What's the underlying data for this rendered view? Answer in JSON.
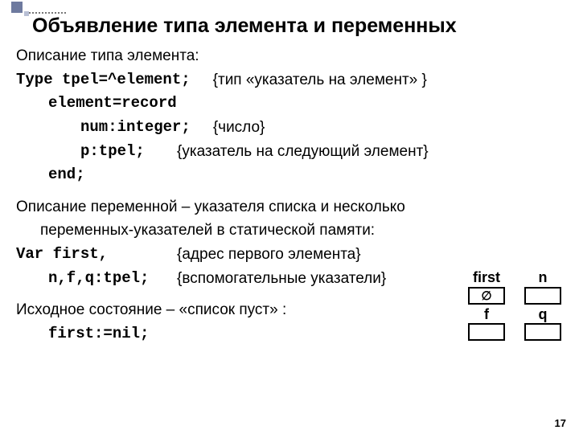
{
  "title": "Объявление типа элемента и переменных",
  "l1": "Описание типа элемента:",
  "l2a": "Type tpel=^element;",
  "l2b": "{тип «указатель на элемент» }",
  "l3": "element=record",
  "l4a": "num:integer;",
  "l4b": "{число}",
  "l5a": "p:tpel;",
  "l5b": "{указатель на следующий элемент}",
  "l6": "end;",
  "p2a": "Описание переменной – указателя  списка и несколько",
  "p2b": "переменных-указателей в статической памяти:",
  "l7a": "Var first,",
  "l7b": "{адрес первого элемента}",
  "l8a": "n,f,q:tpel;",
  "l8b": "{вспомогательные указатели}",
  "p3": "Исходное состояние – «список пуст» :",
  "l9": "first:=nil;",
  "box": {
    "first": "first",
    "n": "n",
    "f": "f",
    "q": "q",
    "nil": "∅"
  },
  "page": "17"
}
